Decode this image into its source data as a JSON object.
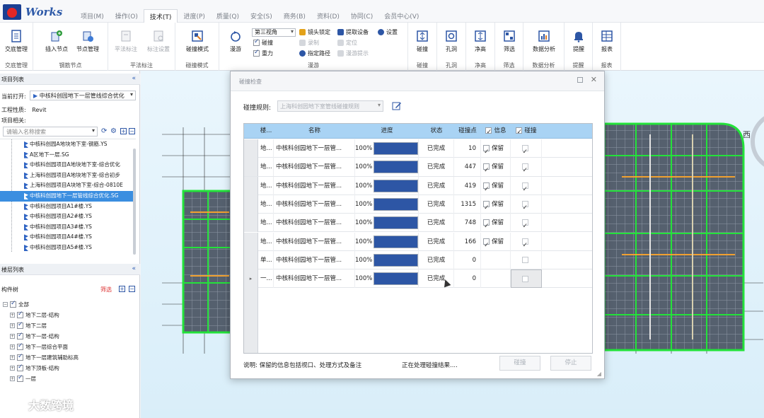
{
  "app": {
    "name": "Works",
    "brand_color": "#2e5aa8",
    "logo_colors": {
      "box": "#1b3f93",
      "dot": "#e32727"
    }
  },
  "menu": [
    {
      "label": "项目(M)",
      "active": false
    },
    {
      "label": "操作(O)",
      "active": false
    },
    {
      "label": "技术(T)",
      "active": true
    },
    {
      "label": "进度(P)",
      "active": false
    },
    {
      "label": "质量(Q)",
      "active": false
    },
    {
      "label": "安全(S)",
      "active": false
    },
    {
      "label": "商务(B)",
      "active": false
    },
    {
      "label": "资料(D)",
      "active": false
    },
    {
      "label": "协同(C)",
      "active": false
    },
    {
      "label": "会员中心(V)",
      "active": false
    }
  ],
  "ribbon": {
    "groups": {
      "disclosure": "交底管理",
      "rebar_nodes": "钢筋节点",
      "plan_annotation": "平法标注",
      "collision_mode": "碰撞模式",
      "walkthrough": "漫游",
      "collision": "碰撞",
      "opening": "孔洞",
      "clearance": "净高",
      "filter": "筛选",
      "data_analysis": "数据分析",
      "reminder": "提醒",
      "report": "报表"
    },
    "buttons": {
      "disclosure_mgmt": "交底管理",
      "insert_node": "插入节点",
      "node_mgmt": "节点管理",
      "plan_annotate": "平法标注",
      "annotate_settings": "标注设置",
      "collision_mode": "碰撞模式",
      "walkthrough": "漫游",
      "collision": "碰撞",
      "opening": "孔洞",
      "clearance": "净高",
      "filter": "筛选",
      "data_analysis": "数据分析",
      "reminder": "提醒",
      "report": "报表"
    },
    "view_select": "第三视角",
    "walk_options": {
      "collision_chk": "碰撞",
      "gravity_chk": "重力",
      "lens_lock": "镜头锁定",
      "record": "录制",
      "set_path": "指定路径",
      "extract_device": "提取设备",
      "locate": "定位",
      "walk_hint": "漫游提示",
      "settings": "设置"
    }
  },
  "left_panel": {
    "project_list_title": "项目列表",
    "current_open_label": "当前打开:",
    "current_open_value": "中核科创园地下一层管线综合优化",
    "engineering_label": "工程性质:",
    "engineering_value": "Revit",
    "project_related_label": "项目相关:",
    "search_placeholder": "请输入名称搜索",
    "projects": [
      {
        "name": "中核科创园A地块地下室-钢筋.YS",
        "selected": false
      },
      {
        "name": "A区地下一层.SG",
        "selected": false
      },
      {
        "name": "中核科创园项目A地块地下室-综合优化",
        "selected": false
      },
      {
        "name": "上海科创园项目A地块地下室-综合初步",
        "selected": false
      },
      {
        "name": "上海科创园项目A块地下室-综合-0810E",
        "selected": false
      },
      {
        "name": "中核科创园地下一层管线综合优化.SG",
        "selected": true
      },
      {
        "name": "中核科创园项目A1#楼.YS",
        "selected": false
      },
      {
        "name": "中核科创园项目A2#楼.YS",
        "selected": false
      },
      {
        "name": "中核科创园项目A3#楼.YS",
        "selected": false
      },
      {
        "name": "中核科创园项目A4#楼.YS",
        "selected": false
      },
      {
        "name": "中核科创园项目A5#楼.YS",
        "selected": false
      }
    ],
    "floor_list_title": "楼层列表",
    "component_tree_label": "构件树",
    "filter_label": "筛选",
    "tree": [
      {
        "label": "全部",
        "level": 0
      },
      {
        "label": "地下二层-结构",
        "level": 1
      },
      {
        "label": "地下二层",
        "level": 1
      },
      {
        "label": "地下一层-结构",
        "level": 1
      },
      {
        "label": "地下一层综合平面",
        "level": 1
      },
      {
        "label": "地下一层建筑辅助标高",
        "level": 1
      },
      {
        "label": "地下顶板-结构",
        "level": 1
      },
      {
        "label": "一层",
        "level": 1
      }
    ]
  },
  "dialog": {
    "title": "碰撞检查",
    "rule_label": "碰撞规则:",
    "rule_value": "上海科创园地下室管线碰撞规则",
    "columns": {
      "floor": "楼...",
      "name": "名称",
      "progress": "进度",
      "status": "状态",
      "points": "碰撞点",
      "info": "信息",
      "collide": "碰撞"
    },
    "rows": [
      {
        "floor": "地...",
        "name": "中核科创园地下一层管...",
        "percent_text": "100%",
        "progress": 1.0,
        "status": "已完成",
        "points": "10",
        "info": "保留",
        "info_checked": true,
        "collide_checked": true
      },
      {
        "floor": "地...",
        "name": "中核科创园地下一层管...",
        "percent_text": "100%",
        "progress": 1.0,
        "status": "已完成",
        "points": "447",
        "info": "保留",
        "info_checked": true,
        "collide_checked": true
      },
      {
        "floor": "地...",
        "name": "中核科创园地下一层管...",
        "percent_text": "100%",
        "progress": 1.0,
        "status": "已完成",
        "points": "419",
        "info": "保留",
        "info_checked": true,
        "collide_checked": true
      },
      {
        "floor": "地...",
        "name": "中核科创园地下一层管...",
        "percent_text": "100%",
        "progress": 1.0,
        "status": "已完成",
        "points": "1315",
        "info": "保留",
        "info_checked": true,
        "collide_checked": true
      },
      {
        "floor": "地...",
        "name": "中核科创园地下一层管...",
        "percent_text": "100%",
        "progress": 1.0,
        "status": "已完成",
        "points": "748",
        "info": "保留",
        "info_checked": true,
        "collide_checked": true
      },
      {
        "floor": "地...",
        "name": "中核科创园地下一层管...",
        "percent_text": "100%",
        "progress": 1.0,
        "status": "已完成",
        "points": "166",
        "info": "保留",
        "info_checked": true,
        "collide_checked": true
      },
      {
        "floor": "单...",
        "name": "中核科创园地下一层管...",
        "percent_text": "100%",
        "progress": 1.0,
        "status": "已完成",
        "points": "0",
        "info": "",
        "info_checked": false,
        "collide_checked": false
      },
      {
        "floor": "一...",
        "name": "中核科创园地下一层管...",
        "percent_text": "100%",
        "progress": 1.0,
        "status": "已完成",
        "points": "0",
        "info": "",
        "info_checked": false,
        "collide_checked": false
      }
    ],
    "note": "说明: 保留的信息包括视口、处理方式及备注",
    "status_text": "正在处理碰撞结果....",
    "collide_button": "碰撞",
    "stop_button": "停止"
  },
  "viewport": {
    "compass": "西"
  },
  "watermark": "大数跨境"
}
